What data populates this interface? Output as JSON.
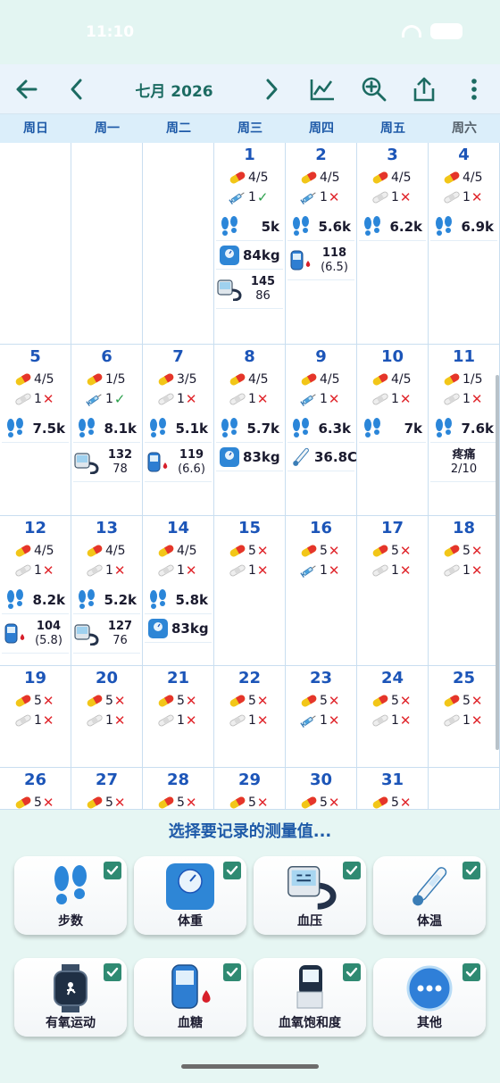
{
  "status": {
    "time": "11:10"
  },
  "toolbar": {
    "title": "七月 2026"
  },
  "weekdays": [
    "周日",
    "周一",
    "周二",
    "周三",
    "周四",
    "周五",
    "周六"
  ],
  "days": [
    {
      "d": "1",
      "pill": "4/5",
      "pill_state": "none",
      "inj": "1",
      "inj_state": "ok",
      "inj_kind": "syringe",
      "rows": [
        {
          "k": "steps",
          "v": "5k"
        },
        {
          "k": "scale",
          "v": "84kg"
        },
        {
          "k": "bp",
          "v": "145",
          "s": "86"
        }
      ]
    },
    {
      "d": "2",
      "pill": "4/5",
      "pill_state": "none",
      "inj": "1",
      "inj_state": "x",
      "inj_kind": "syringe",
      "rows": [
        {
          "k": "steps",
          "v": "5.6k"
        },
        {
          "k": "glucose",
          "v": "118",
          "s": "(6.5)"
        }
      ]
    },
    {
      "d": "3",
      "pill": "4/5",
      "pill_state": "none",
      "inj": "1",
      "inj_state": "x",
      "inj_kind": "bandage",
      "rows": [
        {
          "k": "steps",
          "v": "6.2k"
        }
      ]
    },
    {
      "d": "4",
      "pill": "4/5",
      "pill_state": "none",
      "inj": "1",
      "inj_state": "x",
      "inj_kind": "bandage",
      "rows": [
        {
          "k": "steps",
          "v": "6.9k"
        }
      ]
    },
    {
      "d": "5",
      "pill": "4/5",
      "pill_state": "none",
      "inj": "1",
      "inj_state": "x",
      "inj_kind": "bandage",
      "rows": [
        {
          "k": "steps",
          "v": "7.5k"
        }
      ]
    },
    {
      "d": "6",
      "pill": "1/5",
      "pill_state": "none",
      "inj": "1",
      "inj_state": "ok",
      "inj_kind": "syringe",
      "rows": [
        {
          "k": "steps",
          "v": "8.1k"
        },
        {
          "k": "bp",
          "v": "132",
          "s": "78"
        }
      ]
    },
    {
      "d": "7",
      "pill": "3/5",
      "pill_state": "none",
      "inj": "1",
      "inj_state": "x",
      "inj_kind": "bandage",
      "rows": [
        {
          "k": "steps",
          "v": "5.1k"
        },
        {
          "k": "glucose",
          "v": "119",
          "s": "(6.6)"
        }
      ]
    },
    {
      "d": "8",
      "pill": "4/5",
      "pill_state": "none",
      "inj": "1",
      "inj_state": "x",
      "inj_kind": "bandage",
      "rows": [
        {
          "k": "steps",
          "v": "5.7k"
        },
        {
          "k": "scale",
          "v": "83kg"
        }
      ]
    },
    {
      "d": "9",
      "pill": "4/5",
      "pill_state": "none",
      "inj": "1",
      "inj_state": "x",
      "inj_kind": "syringe",
      "rows": [
        {
          "k": "steps",
          "v": "6.3k"
        },
        {
          "k": "thermo",
          "v": "36.8C"
        }
      ]
    },
    {
      "d": "10",
      "pill": "4/5",
      "pill_state": "none",
      "inj": "1",
      "inj_state": "x",
      "inj_kind": "bandage",
      "rows": [
        {
          "k": "steps",
          "v": "7k"
        }
      ]
    },
    {
      "d": "11",
      "pill": "1/5",
      "pill_state": "none",
      "inj": "1",
      "inj_state": "x",
      "inj_kind": "bandage",
      "rows": [
        {
          "k": "steps",
          "v": "7.6k"
        },
        {
          "k": "text",
          "v": "疼痛",
          "s": "2/10"
        }
      ]
    },
    {
      "d": "12",
      "pill": "4/5",
      "pill_state": "none",
      "inj": "1",
      "inj_state": "x",
      "inj_kind": "bandage",
      "rows": [
        {
          "k": "steps",
          "v": "8.2k"
        },
        {
          "k": "glucose",
          "v": "104",
          "s": "(5.8)"
        }
      ]
    },
    {
      "d": "13",
      "pill": "4/5",
      "pill_state": "none",
      "inj": "1",
      "inj_state": "x",
      "inj_kind": "bandage",
      "rows": [
        {
          "k": "steps",
          "v": "5.2k"
        },
        {
          "k": "bp",
          "v": "127",
          "s": "76"
        }
      ]
    },
    {
      "d": "14",
      "pill": "4/5",
      "pill_state": "none",
      "inj": "1",
      "inj_state": "x",
      "inj_kind": "bandage",
      "rows": [
        {
          "k": "steps",
          "v": "5.8k"
        },
        {
          "k": "scale",
          "v": "83kg"
        }
      ]
    },
    {
      "d": "15",
      "pill": "5",
      "pill_state": "x",
      "inj": "1",
      "inj_state": "x",
      "inj_kind": "bandage",
      "rows": []
    },
    {
      "d": "16",
      "pill": "5",
      "pill_state": "x",
      "inj": "1",
      "inj_state": "x",
      "inj_kind": "syringe",
      "rows": []
    },
    {
      "d": "17",
      "pill": "5",
      "pill_state": "x",
      "inj": "1",
      "inj_state": "x",
      "inj_kind": "bandage",
      "rows": []
    },
    {
      "d": "18",
      "pill": "5",
      "pill_state": "x",
      "inj": "1",
      "inj_state": "x",
      "inj_kind": "bandage",
      "rows": []
    },
    {
      "d": "19",
      "pill": "5",
      "pill_state": "x",
      "inj": "1",
      "inj_state": "x",
      "inj_kind": "bandage",
      "rows": []
    },
    {
      "d": "20",
      "pill": "5",
      "pill_state": "x",
      "inj": "1",
      "inj_state": "x",
      "inj_kind": "bandage",
      "rows": []
    },
    {
      "d": "21",
      "pill": "5",
      "pill_state": "x",
      "inj": "1",
      "inj_state": "x",
      "inj_kind": "bandage",
      "rows": []
    },
    {
      "d": "22",
      "pill": "5",
      "pill_state": "x",
      "inj": "1",
      "inj_state": "x",
      "inj_kind": "bandage",
      "rows": []
    },
    {
      "d": "23",
      "pill": "5",
      "pill_state": "x",
      "inj": "1",
      "inj_state": "x",
      "inj_kind": "syringe",
      "rows": []
    },
    {
      "d": "24",
      "pill": "5",
      "pill_state": "x",
      "inj": "1",
      "inj_state": "x",
      "inj_kind": "bandage",
      "rows": []
    },
    {
      "d": "25",
      "pill": "5",
      "pill_state": "x",
      "inj": "1",
      "inj_state": "x",
      "inj_kind": "bandage",
      "rows": []
    },
    {
      "d": "26",
      "pill": "5",
      "pill_state": "x",
      "inj": "",
      "inj_state": "none",
      "inj_kind": "none",
      "rows": []
    },
    {
      "d": "27",
      "pill": "5",
      "pill_state": "x",
      "inj": "",
      "inj_state": "none",
      "inj_kind": "none",
      "rows": []
    },
    {
      "d": "28",
      "pill": "5",
      "pill_state": "x",
      "inj": "",
      "inj_state": "none",
      "inj_kind": "none",
      "rows": []
    },
    {
      "d": "29",
      "pill": "5",
      "pill_state": "x",
      "inj": "",
      "inj_state": "none",
      "inj_kind": "none",
      "rows": []
    },
    {
      "d": "30",
      "pill": "5",
      "pill_state": "x",
      "inj": "",
      "inj_state": "none",
      "inj_kind": "none",
      "rows": []
    },
    {
      "d": "31",
      "pill": "5",
      "pill_state": "x",
      "inj": "",
      "inj_state": "none",
      "inj_kind": "none",
      "rows": []
    }
  ],
  "sheet": {
    "title": "选择要记录的测量值...",
    "items": [
      {
        "label": "步数",
        "icon": "steps-icon",
        "checked": true
      },
      {
        "label": "体重",
        "icon": "scale-icon",
        "checked": true
      },
      {
        "label": "血压",
        "icon": "blood-pressure-icon",
        "checked": true
      },
      {
        "label": "体温",
        "icon": "thermometer-icon",
        "checked": true
      },
      {
        "label": "有氧运动",
        "icon": "smartwatch-icon",
        "checked": true
      },
      {
        "label": "血糖",
        "icon": "glucose-meter-icon",
        "checked": true
      },
      {
        "label": "血氧饱和度",
        "icon": "pulse-oximeter-icon",
        "checked": true
      },
      {
        "label": "其他",
        "icon": "more-icon",
        "checked": true
      }
    ]
  },
  "colors": {
    "accent": "#1c6b62",
    "daynum": "#1c55b8",
    "x": "#e0282e",
    "ok": "#2aa04b"
  }
}
